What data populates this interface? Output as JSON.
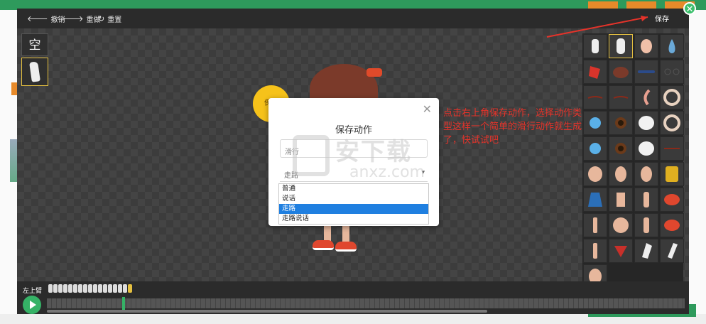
{
  "toolbar": {
    "undo_label": "撤销",
    "redo_label": "重做",
    "reset_label": "重置",
    "save_label": "保存"
  },
  "left_parts": {
    "empty_label": "空"
  },
  "save_badge": "保存",
  "annotation": "点击右上角保存动作，选择动作类型这样一个简单的滑行动作就生成了，快试试吧",
  "dialog": {
    "title": "保存动作",
    "name_placeholder": "滑行",
    "type_value": "走路",
    "options": [
      "普通",
      "说话",
      "走路",
      "走路说话"
    ],
    "selected_option": "走路"
  },
  "watermark": {
    "title": "安下载",
    "sub": "anxz.com"
  },
  "timeline": {
    "label": "左上臂"
  },
  "colors": {
    "accent_green": "#35b266",
    "selection_yellow": "#e5c040",
    "annotation_red": "#e5332a",
    "option_selected": "#1f7fe0"
  }
}
